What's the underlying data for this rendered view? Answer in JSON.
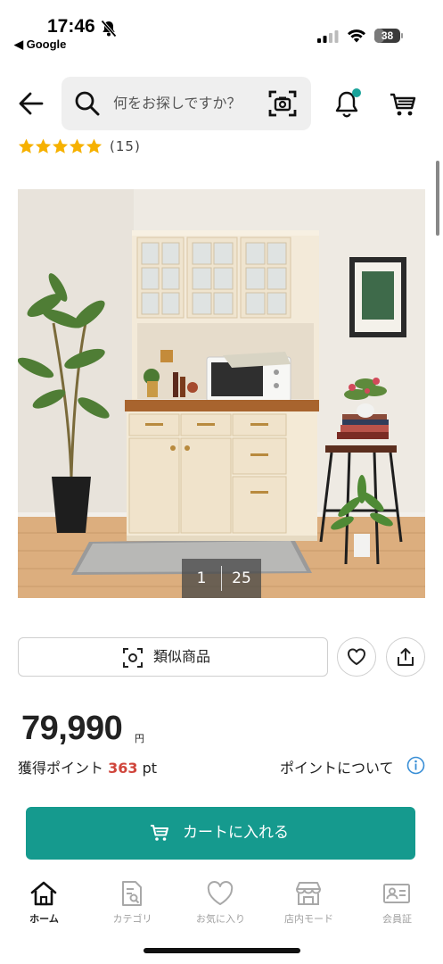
{
  "status_bar": {
    "time": "17:46",
    "back_app": "◀ Google",
    "battery_level": "38",
    "icons": [
      "bell-slash-icon",
      "cellular-signal-icon",
      "wifi-icon",
      "battery-icon"
    ]
  },
  "header": {
    "search_placeholder": "何をお探しですか？",
    "icons": [
      "back-arrow-icon",
      "search-icon",
      "camera-search-icon",
      "bell-icon",
      "cart-icon"
    ],
    "notification_dot_color": "#1aa39a"
  },
  "product": {
    "rating_stars": 5,
    "review_count": "(15)",
    "star_color": "#f6b100",
    "image_index": "1",
    "image_total": "25",
    "similar_label": "類似商品",
    "price": "79,990",
    "price_unit": "円",
    "points_label": "獲得ポイント",
    "points_value": "363",
    "points_unit": "pt",
    "points_link": "ポイントについて",
    "points_color": "#d0463c"
  },
  "cta": {
    "add_to_cart": "カートに入れる",
    "color": "#159a8e"
  },
  "bottom_nav": [
    {
      "label": "ホーム",
      "icon": "home-icon",
      "active": true
    },
    {
      "label": "カテゴリ",
      "icon": "category-icon",
      "active": false
    },
    {
      "label": "お気に入り",
      "icon": "heart-icon",
      "active": false
    },
    {
      "label": "店内モード",
      "icon": "store-icon",
      "active": false
    },
    {
      "label": "会員証",
      "icon": "member-card-icon",
      "active": false
    }
  ]
}
